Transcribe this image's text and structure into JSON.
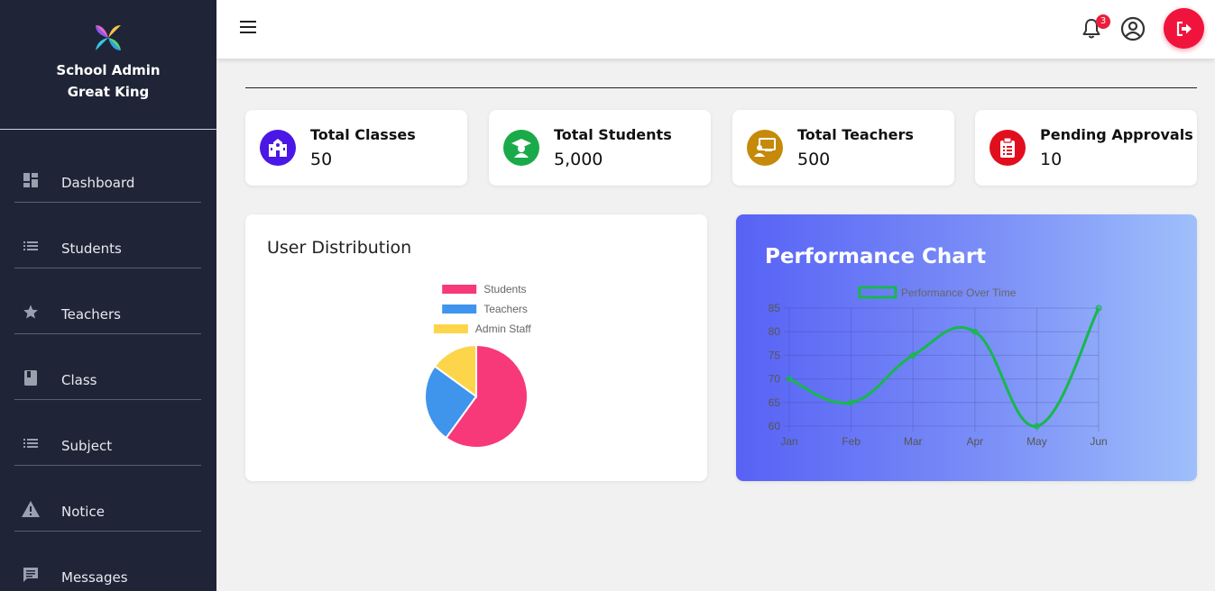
{
  "brand": {
    "line1": "School Admin",
    "line2": "Great King"
  },
  "sidebar": {
    "items": [
      {
        "label": "Dashboard",
        "icon": "dashboard-icon"
      },
      {
        "label": "Students",
        "icon": "list-icon"
      },
      {
        "label": "Teachers",
        "icon": "star-icon"
      },
      {
        "label": "Class",
        "icon": "book-icon"
      },
      {
        "label": "Subject",
        "icon": "list-icon"
      },
      {
        "label": "Notice",
        "icon": "warning-icon"
      },
      {
        "label": "Messages",
        "icon": "message-icon"
      }
    ]
  },
  "topbar": {
    "notification_count": "3"
  },
  "stats": [
    {
      "title": "Total Classes",
      "value": "50",
      "color": "#4a17e6"
    },
    {
      "title": "Total Students",
      "value": "5,000",
      "color": "#1aaa4a"
    },
    {
      "title": "Total Teachers",
      "value": "500",
      "color": "#c58a0a"
    },
    {
      "title": "Pending Approvals",
      "value": "10",
      "color": "#e10e1e"
    }
  ],
  "user_distribution": {
    "title": "User Distribution"
  },
  "performance": {
    "title": "Performance Chart"
  },
  "chart_data": [
    {
      "type": "pie",
      "title": "",
      "categories": [
        "Students",
        "Teachers",
        "Admin Staff"
      ],
      "values": [
        60,
        25,
        15
      ],
      "colors": [
        "#f7397a",
        "#3f94ec",
        "#fdd54a"
      ],
      "legend": "top"
    },
    {
      "type": "line",
      "x": [
        "Jan",
        "Feb",
        "Mar",
        "Apr",
        "May",
        "Jun"
      ],
      "series": [
        {
          "name": "Performance Over Time",
          "values": [
            70,
            65,
            75,
            80,
            60,
            85
          ],
          "color": "#17b84c"
        }
      ],
      "ylim": [
        60,
        85
      ],
      "yticks": [
        60,
        65,
        70,
        75,
        80,
        85
      ],
      "grid": true,
      "legend": "top"
    }
  ]
}
